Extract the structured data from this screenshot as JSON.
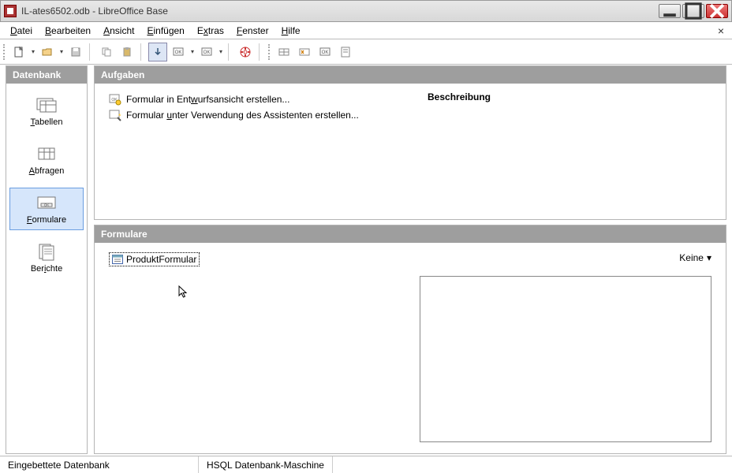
{
  "window": {
    "title": "IL-ates6502.odb - LibreOffice Base"
  },
  "menu": {
    "file": "Datei",
    "edit": "Bearbeiten",
    "view": "Ansicht",
    "insert": "Einfügen",
    "extras": "Extras",
    "window": "Fenster",
    "help": "Hilfe"
  },
  "sidebar": {
    "header": "Datenbank",
    "items": [
      {
        "label_pre": "",
        "accel": "T",
        "label_post": "abellen"
      },
      {
        "label_pre": "",
        "accel": "A",
        "label_post": "bfragen"
      },
      {
        "label_pre": "",
        "accel": "F",
        "label_post": "ormulare"
      },
      {
        "label_pre": "Ber",
        "accel": "i",
        "label_post": "chte"
      }
    ]
  },
  "tasks": {
    "header": "Aufgaben",
    "task1_pre": "Formular in Ent",
    "task1_accel": "w",
    "task1_post": "urfsansicht erstellen...",
    "task2_pre": "Formular ",
    "task2_accel": "u",
    "task2_post": "nter Verwendung des Assistenten erstellen...",
    "desc_label": "Beschreibung"
  },
  "forms": {
    "header": "Formulare",
    "item_name": "ProduktFormular",
    "view_label": "Keine"
  },
  "status": {
    "left": "Eingebettete Datenbank",
    "engine": "HSQL Datenbank-Maschine"
  }
}
